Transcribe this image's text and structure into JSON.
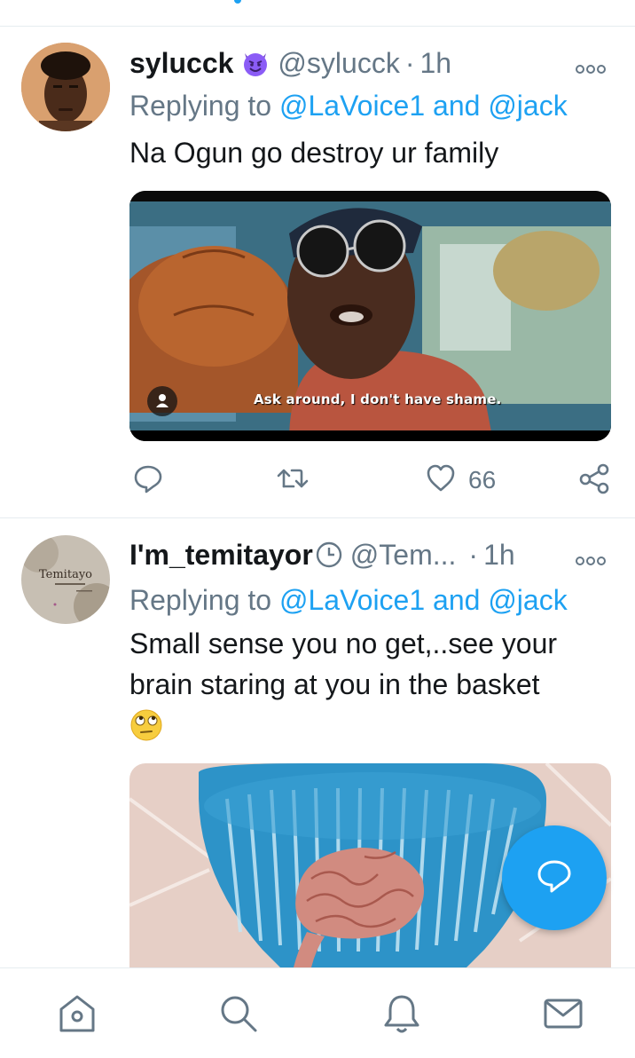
{
  "tweets": [
    {
      "name": "sylucck",
      "badge_icon": "smiling-devil-emoji",
      "handle": "@sylucck",
      "separator": "·",
      "time": "1h",
      "replying_prefix": "Replying to",
      "reply_to_1": "@LaVoice1",
      "reply_and": "and",
      "reply_to_2": "@jack",
      "text": "Na Ogun go destroy ur family",
      "media_caption": "Ask around, I don't have shame.",
      "replies_icon": "comment-icon",
      "retweet_icon": "retweet-icon",
      "likes": "66",
      "share_icon": "share-icon"
    },
    {
      "name": "I'm_temitayor",
      "badge_icon": "clock-emoji",
      "handle": "@Tem...",
      "separator": "·",
      "time": "1h",
      "replying_prefix": "Replying to",
      "reply_to_1": "@LaVoice1",
      "reply_and": "and",
      "reply_to_2": "@jack",
      "text": "Small sense you no get,..see your brain staring at you in the basket",
      "avatar_text": "Temitayo",
      "text_emoji": "face-with-rolling-eyes-emoji"
    }
  ],
  "fab_icon": "compose-reply-icon",
  "nav": [
    {
      "icon": "home-icon"
    },
    {
      "icon": "search-icon"
    },
    {
      "icon": "notifications-icon"
    },
    {
      "icon": "messages-icon"
    }
  ],
  "colors": {
    "accent": "#1da1f2",
    "secondary_text": "#657786",
    "primary_text": "#14171a",
    "divider": "#e6ecf0"
  }
}
